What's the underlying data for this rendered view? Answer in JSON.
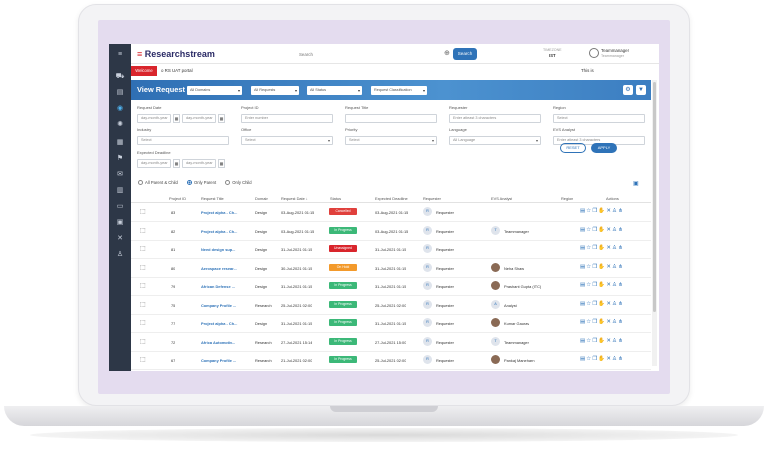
{
  "topbar": {
    "logo_mark": "≡",
    "logo_text": "Researchstream",
    "search_placeholder": "Search",
    "search_button": "Search",
    "tz_label": "TIMEZONE",
    "tz_value": "IST",
    "user_name": "Teammanager",
    "user_role": "Teammanager"
  },
  "welcome": {
    "tag": "Welcome",
    "text": "o RS UAT portal",
    "right": "This is"
  },
  "header": {
    "title": "View Request",
    "dropdowns": [
      "All Domains",
      "All Requests",
      "All Status",
      "Request Classification"
    ]
  },
  "filters": {
    "request_date_label": "Request Date",
    "date_placeholder": "day-month-year",
    "project_id_label": "Project ID",
    "project_id_placeholder": "Enter number",
    "request_title_label": "Request Title",
    "requester_label": "Requester",
    "requester_placeholder": "Enter atleast 3 characters",
    "region_label": "Region",
    "region_value": "Select",
    "industry_label": "Industry",
    "industry_value": "Select",
    "office_label": "Office",
    "office_value": "Select",
    "priority_label": "Priority",
    "priority_value": "Select",
    "language_label": "Language",
    "language_value": "All Language",
    "analyst_label": "EVS Analyst",
    "analyst_placeholder": "Enter atleast 3 characters",
    "deadline_label": "Expected Deadline",
    "reset": "RESET",
    "apply": "APPLY"
  },
  "radios": [
    "All Parent & Child",
    "Only Parent",
    "Only Child"
  ],
  "table": {
    "headers": [
      "Project ID",
      "Request Title",
      "Domain",
      "Request Date ↓",
      "Status",
      "Expected Deadline",
      "Requester",
      "EVS Analyst",
      "Region",
      "Actions"
    ],
    "rows": [
      {
        "id": "83",
        "title": "Project alpha - Ch...",
        "domain": "Design",
        "date": "03-Aug-2021 01:15",
        "status": "Cancelled",
        "status_color": "#e0403c",
        "deadline": "03-Aug-2021 01:15",
        "requester": "Requester",
        "analyst_initial": "",
        "analyst": "",
        "analyst_photo": false
      },
      {
        "id": "82",
        "title": "Project alpha - Ch...",
        "domain": "Design",
        "date": "03-Aug-2021 01:15",
        "status": "In Progress",
        "status_color": "#3cb878",
        "deadline": "03-Aug-2021 01:15",
        "requester": "Requester",
        "analyst_initial": "T",
        "analyst": "Teammanager",
        "analyst_photo": false
      },
      {
        "id": "81",
        "title": "Need design sup...",
        "domain": "Design",
        "date": "31-Jul-2021 01:15",
        "status": "Unassigned",
        "status_color": "#d9252c",
        "deadline": "31-Jul-2021 01:15",
        "requester": "Requester",
        "analyst_initial": "",
        "analyst": "",
        "analyst_photo": false
      },
      {
        "id": "80",
        "title": "Aerospace resear...",
        "domain": "Design",
        "date": "30-Jul-2021 01:15",
        "status": "On Hold",
        "status_color": "#f39a2b",
        "deadline": "31-Jul-2021 01:15",
        "requester": "Requester",
        "analyst_initial": "",
        "analyst": "Neha Shaw",
        "analyst_photo": true
      },
      {
        "id": "79",
        "title": "African Defense ...",
        "domain": "Design",
        "date": "31-Jul-2021 01:15",
        "status": "In Progress",
        "status_color": "#3cb878",
        "deadline": "31-Jul-2021 01:15",
        "requester": "Requester",
        "analyst_initial": "",
        "analyst": "Prashant Gupta (ITC)",
        "analyst_photo": true
      },
      {
        "id": "75",
        "title": "Company Profile ...",
        "domain": "Research",
        "date": "25-Jul-2021 02:00",
        "status": "In Progress",
        "status_color": "#3cb878",
        "deadline": "25-Jul-2021 02:00",
        "requester": "Requester",
        "analyst_initial": "A",
        "analyst": "Analyst",
        "analyst_photo": false
      },
      {
        "id": "77",
        "title": "Project alpha - Ch...",
        "domain": "Design",
        "date": "31-Jul-2021 01:15",
        "status": "In Progress",
        "status_color": "#3cb878",
        "deadline": "31-Jul-2021 01:15",
        "requester": "Requester",
        "analyst_initial": "",
        "analyst": "Kumar Gaurav",
        "analyst_photo": true
      },
      {
        "id": "72",
        "title": "Africa Automotiv...",
        "domain": "Research",
        "date": "27-Jul-2021 15:14",
        "status": "In Progress",
        "status_color": "#3cb878",
        "deadline": "27-Jul-2021 15:00",
        "requester": "Requester",
        "analyst_initial": "T",
        "analyst": "Teammanager",
        "analyst_photo": false
      },
      {
        "id": "67",
        "title": "Company Profile ...",
        "domain": "Research",
        "date": "21-Jul-2021 02:00",
        "status": "In Progress",
        "status_color": "#3cb878",
        "deadline": "25-Jul-2021 02:00",
        "requester": "Requester",
        "analyst_initial": "",
        "analyst": "Pankaj Maneharn",
        "analyst_photo": true
      }
    ]
  },
  "icons": {
    "sidebar": [
      "menu-icon",
      "car-icon",
      "document-icon",
      "eye-icon",
      "bulb-icon",
      "grid-icon",
      "flag-icon",
      "mail-icon",
      "chart-icon",
      "file-icon",
      "archive-icon",
      "tools-icon",
      "user-icon"
    ],
    "actions": [
      "document-icon",
      "star-icon",
      "copy-icon",
      "hand-icon",
      "close-icon",
      "person-icon",
      "hierarchy-icon"
    ]
  }
}
